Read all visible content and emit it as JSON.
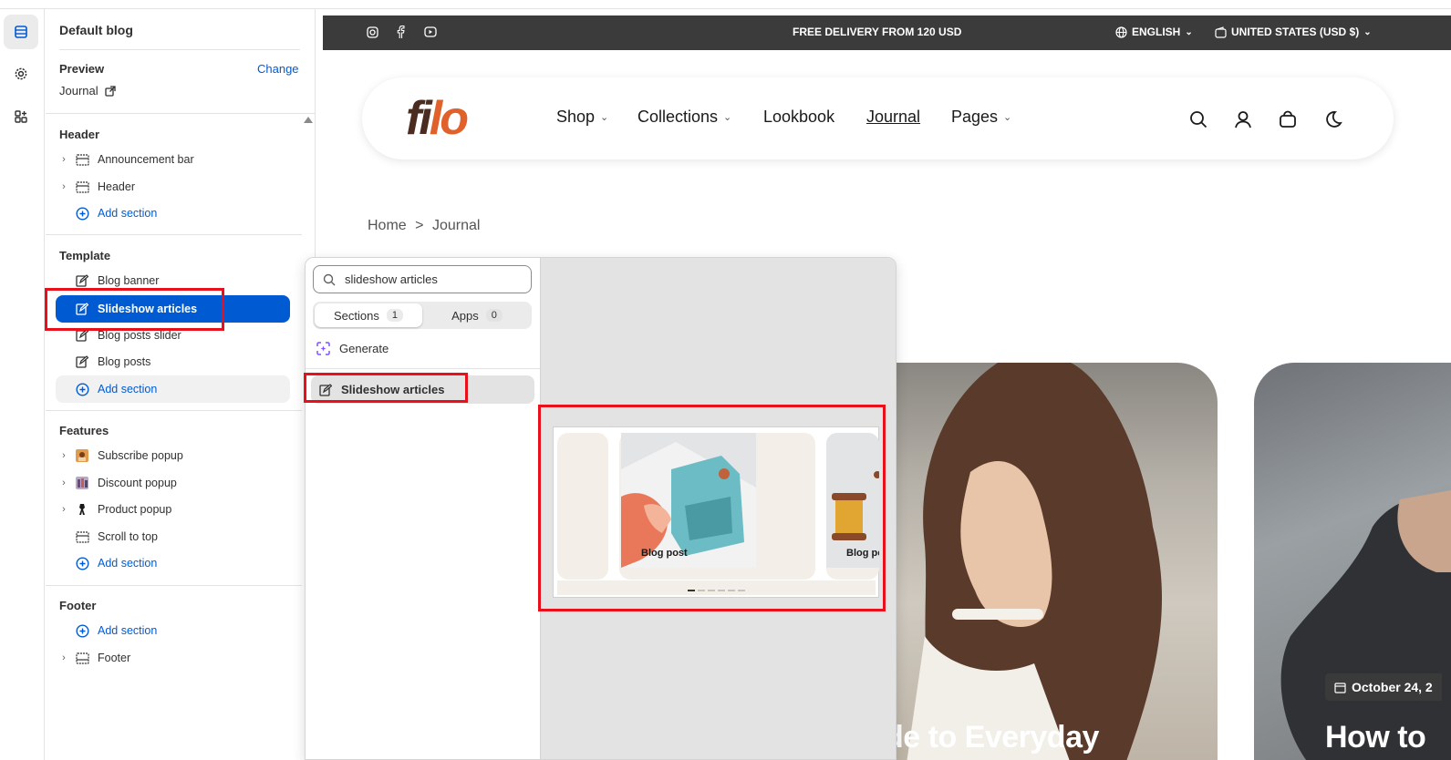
{
  "sidebar": {
    "title": "Default blog",
    "preview": {
      "label": "Preview",
      "change": "Change",
      "page": "Journal"
    },
    "header_group": {
      "title": "Header",
      "items": [
        {
          "label": "Announcement bar",
          "icon": "section-icon"
        },
        {
          "label": "Header",
          "icon": "section-icon"
        }
      ],
      "add": "Add section"
    },
    "template_group": {
      "title": "Template",
      "items": [
        {
          "label": "Blog banner",
          "icon": "edit-section-icon"
        },
        {
          "label": "Slideshow articles",
          "icon": "edit-section-icon",
          "selected": true
        },
        {
          "label": "Blog posts slider",
          "icon": "edit-section-icon"
        },
        {
          "label": "Blog posts",
          "icon": "edit-section-icon"
        }
      ],
      "add": "Add section"
    },
    "features_group": {
      "title": "Features",
      "items": [
        {
          "label": "Subscribe popup",
          "icon": "app-image-icon"
        },
        {
          "label": "Discount popup",
          "icon": "app-image-icon"
        },
        {
          "label": "Product popup",
          "icon": "app-image-icon"
        },
        {
          "label": "Scroll to top",
          "icon": "section-icon"
        }
      ],
      "add": "Add section"
    },
    "footer_group": {
      "title": "Footer",
      "add": "Add section",
      "items": [
        {
          "label": "Footer",
          "icon": "section-icon"
        }
      ]
    }
  },
  "picker": {
    "search_value": "slideshow articles",
    "tabs": [
      {
        "label": "Sections",
        "count": "1"
      },
      {
        "label": "Apps",
        "count": "0"
      }
    ],
    "generate": "Generate",
    "result": "Slideshow articles",
    "preview_cards": [
      "Blog post",
      "Blog po"
    ]
  },
  "store": {
    "announcement": "FREE DELIVERY FROM 120 USD",
    "language": "ENGLISH",
    "currency": "UNITED STATES (USD $)",
    "logo": "filo",
    "nav": [
      "Shop",
      "Collections",
      "Lookbook",
      "Journal",
      "Pages"
    ],
    "breadcrumb": {
      "home": "Home",
      "sep": ">",
      "current": "Journal"
    },
    "hero1_text": "de to Everyday",
    "hero2_text": "How to",
    "hero2_date": "October 24, 2"
  },
  "colors": {
    "accent": "#005bd3",
    "highlight": "#e8101b",
    "announce_bg": "#3b3b3b",
    "logo_brown": "#4a2c20",
    "logo_orange": "#e0612b"
  }
}
